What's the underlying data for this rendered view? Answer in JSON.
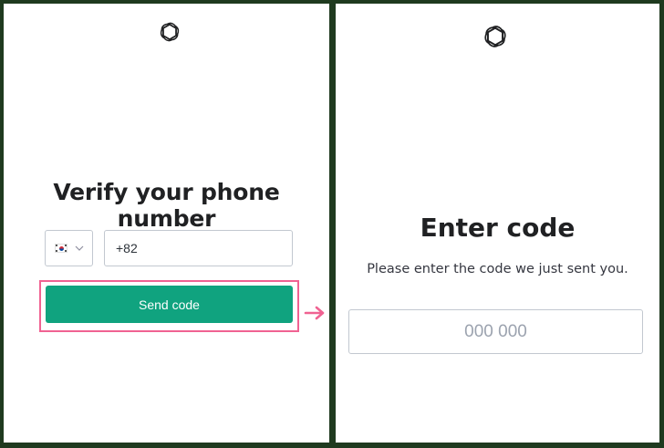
{
  "left_panel": {
    "logo_icon": "openai-logo-icon",
    "title": "Verify your phone number",
    "country_select": {
      "flag_icon": "south-korea-flag-icon",
      "chevron_icon": "chevron-down-icon"
    },
    "phone_input": {
      "value": "+82"
    },
    "send_button_label": "Send code",
    "highlight_color": "#f06292",
    "button_color": "#10a37f"
  },
  "transition_arrow_icon": "arrow-right-icon",
  "right_panel": {
    "logo_icon": "openai-logo-icon",
    "title": "Enter code",
    "subtitle": "Please enter the code we just sent you.",
    "code_input": {
      "placeholder": "000 000"
    }
  },
  "colors": {
    "frame_background": "#1f3a1f",
    "panel_background": "#ffffff",
    "primary": "#10a37f",
    "annotation": "#f06292"
  }
}
